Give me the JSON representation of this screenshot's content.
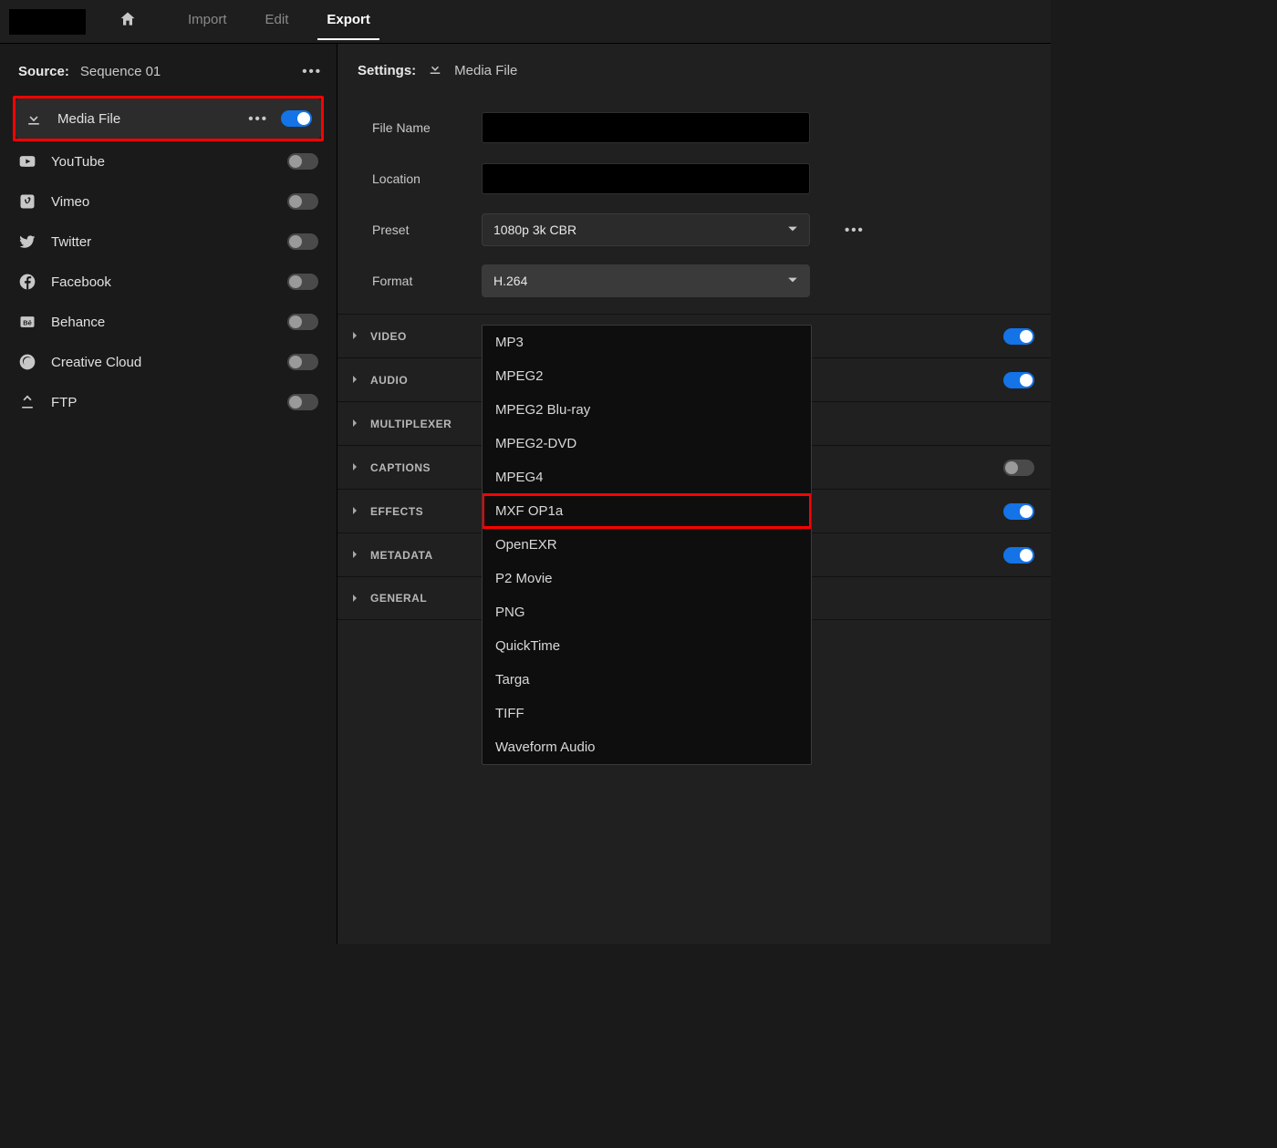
{
  "nav": {
    "tabs": [
      "Import",
      "Edit",
      "Export"
    ],
    "active": "Export"
  },
  "source": {
    "label": "Source:",
    "name": "Sequence 01"
  },
  "destinations": [
    {
      "icon": "download",
      "label": "Media File",
      "on": true,
      "selected": true,
      "dots": true
    },
    {
      "icon": "youtube",
      "label": "YouTube",
      "on": false,
      "selected": false,
      "dots": false
    },
    {
      "icon": "vimeo",
      "label": "Vimeo",
      "on": false,
      "selected": false,
      "dots": false
    },
    {
      "icon": "twitter",
      "label": "Twitter",
      "on": false,
      "selected": false,
      "dots": false
    },
    {
      "icon": "facebook",
      "label": "Facebook",
      "on": false,
      "selected": false,
      "dots": false
    },
    {
      "icon": "behance",
      "label": "Behance",
      "on": false,
      "selected": false,
      "dots": false
    },
    {
      "icon": "cc",
      "label": "Creative Cloud",
      "on": false,
      "selected": false,
      "dots": false
    },
    {
      "icon": "ftp",
      "label": "FTP",
      "on": false,
      "selected": false,
      "dots": false
    }
  ],
  "settings": {
    "label": "Settings:",
    "title": "Media File",
    "fields": {
      "file_name_label": "File Name",
      "location_label": "Location",
      "preset_label": "Preset",
      "preset_value": "1080p 3k CBR",
      "format_label": "Format",
      "format_value": "H.264"
    }
  },
  "format_options": [
    "MP3",
    "MPEG2",
    "MPEG2 Blu-ray",
    "MPEG2-DVD",
    "MPEG4",
    "MXF OP1a",
    "OpenEXR",
    "P2 Movie",
    "PNG",
    "QuickTime",
    "Targa",
    "TIFF",
    "Waveform Audio"
  ],
  "format_highlight": "MXF OP1a",
  "sections": [
    {
      "name": "VIDEO",
      "toggle": true
    },
    {
      "name": "AUDIO",
      "toggle": true
    },
    {
      "name": "MULTIPLEXER",
      "toggle": null
    },
    {
      "name": "CAPTIONS",
      "toggle": false
    },
    {
      "name": "EFFECTS",
      "toggle": true
    },
    {
      "name": "METADATA",
      "toggle": true
    },
    {
      "name": "GENERAL",
      "toggle": null
    }
  ]
}
